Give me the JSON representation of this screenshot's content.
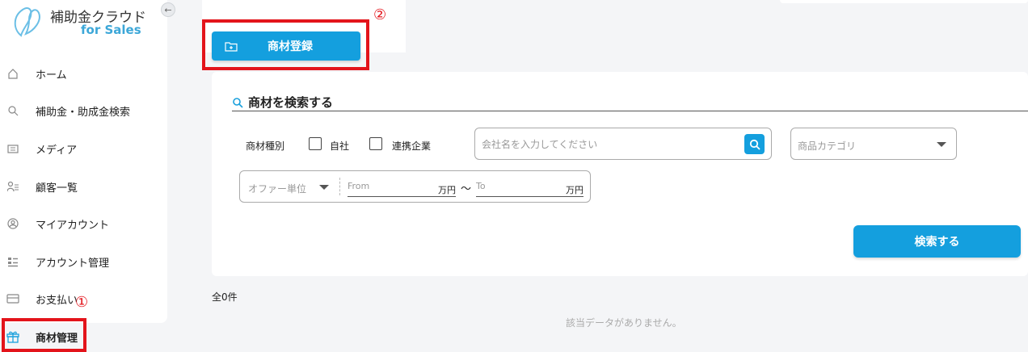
{
  "app": {
    "brand_name": "補助金クラウド",
    "brand_sub": "for Sales"
  },
  "sidebar": {
    "items": [
      {
        "label": "ホーム",
        "icon": "home-icon"
      },
      {
        "label": "補助金・助成金検索",
        "icon": "search-icon"
      },
      {
        "label": "メディア",
        "icon": "media-icon"
      },
      {
        "label": "顧客一覧",
        "icon": "customers-icon"
      },
      {
        "label": "マイアカウント",
        "icon": "account-icon"
      },
      {
        "label": "アカウント管理",
        "icon": "account-management-icon"
      },
      {
        "label": "お支払い",
        "icon": "payment-card-icon"
      },
      {
        "label": "商材管理",
        "icon": "gift-icon",
        "active": true
      }
    ]
  },
  "annotations": {
    "marker_1": "①",
    "marker_2": "②"
  },
  "toolbar": {
    "register_label": "商材登録"
  },
  "search": {
    "title": "商材を検索する",
    "type_label": "商材種別",
    "own_company_label": "自社",
    "partner_label": "連携企業",
    "company_placeholder": "会社名を入力してください",
    "category_placeholder": "商品カテゴリ",
    "offer_unit_placeholder": "オファー単位",
    "from_placeholder": "From",
    "to_placeholder": "To",
    "unit": "万円",
    "tilde": "〜",
    "submit_label": "検索する"
  },
  "results": {
    "count_label": "全0件",
    "empty_message": "該当データがありません。"
  },
  "colors": {
    "accent": "#149fde",
    "highlight": "#e3141b"
  }
}
